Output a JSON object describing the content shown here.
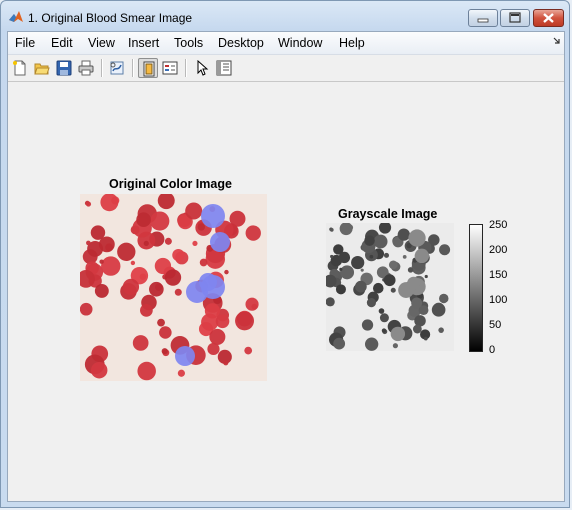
{
  "window": {
    "title": "1. Original Blood Smear Image"
  },
  "menu": {
    "items": [
      "File",
      "Edit",
      "View",
      "Insert",
      "Tools",
      "Desktop",
      "Window",
      "Help"
    ]
  },
  "toolbar": {
    "buttons": [
      {
        "icon": "new-figure-icon"
      },
      {
        "icon": "open-file-icon"
      },
      {
        "icon": "save-figure-icon"
      },
      {
        "icon": "print-figure-icon"
      },
      {
        "icon": "link-plot-icon"
      },
      {
        "icon": "hide-plot-tools-icon",
        "pressed": true
      },
      {
        "icon": "show-plot-tools-icon"
      },
      {
        "icon": "edit-plot-arrow-icon"
      },
      {
        "icon": "open-property-inspector-icon"
      }
    ]
  },
  "figure": {
    "color_image": {
      "title": "Original Color Image",
      "background_color": "#f2e6df"
    },
    "gray_image": {
      "title": "Grayscale Image",
      "background_color": "#ebebeb"
    },
    "colorbar": {
      "ticks": [
        "250",
        "200",
        "150",
        "100",
        "50",
        "0"
      ],
      "range": [
        0,
        255
      ]
    }
  },
  "colors": {
    "red_cell": "#d23a3e",
    "blue_cell": "#7f85f0",
    "close_button": "#c8452f"
  }
}
